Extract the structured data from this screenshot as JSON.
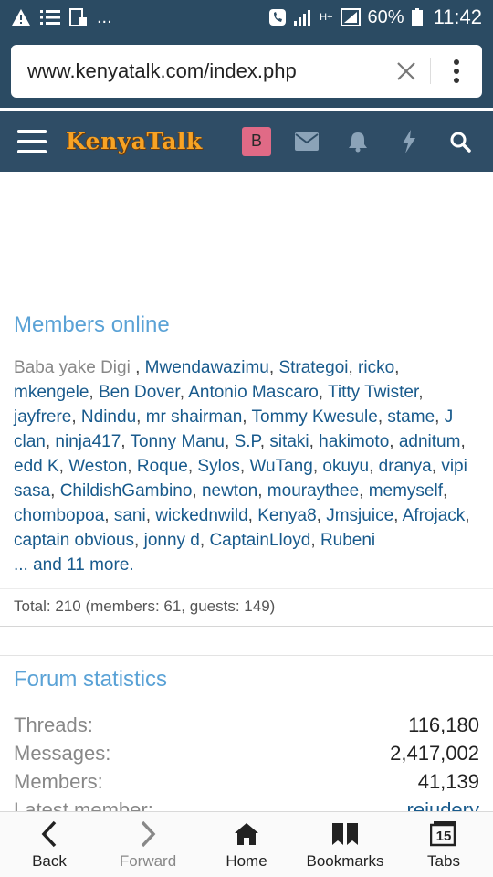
{
  "status_bar": {
    "battery": "60%",
    "time": "11:42",
    "network": "H+"
  },
  "browser": {
    "url": "www.kenyatalk.com/index.php"
  },
  "site_header": {
    "logo": "KenyaTalk",
    "avatar_letter": "B"
  },
  "members_online": {
    "title": "Members online",
    "first_member": "Baba yake Digi",
    "members": [
      "Mwendawazimu",
      "Strategoi",
      "ricko",
      "mkengele",
      "Ben Dover",
      "Antonio Mascaro",
      "Titty Twister",
      "jayfrere",
      "Ndindu",
      "mr shairman",
      "Tommy Kwesule",
      "stame",
      "J clan",
      "ninja417",
      "Tonny Manu",
      "S.P",
      "sitaki",
      "hakimoto",
      "adnitum",
      "edd K",
      "Weston",
      "Roque",
      "Sylos",
      "WuTang",
      "okuyu",
      "dranya",
      "vipi sasa",
      "ChildishGambino",
      "newton",
      "mouraythee",
      "memyself",
      "chombopoa",
      "sani",
      "wickednwild",
      "Kenya8",
      "Jmsjuice",
      "Afrojack",
      "captain obvious",
      "jonny d",
      "CaptainLloyd",
      "Rubeni"
    ],
    "more": "... and 11 more.",
    "total": "Total: 210 (members: 61, guests: 149)"
  },
  "forum_statistics": {
    "title": "Forum statistics",
    "rows": [
      {
        "label": "Threads:",
        "value": "116,180"
      },
      {
        "label": "Messages:",
        "value": "2,417,002"
      },
      {
        "label": "Members:",
        "value": "41,139"
      },
      {
        "label": "Latest member:",
        "value": "rejudery"
      }
    ]
  },
  "bottom_nav": {
    "back": "Back",
    "forward": "Forward",
    "home": "Home",
    "bookmarks": "Bookmarks",
    "tabs": "Tabs",
    "tab_count": "15"
  }
}
